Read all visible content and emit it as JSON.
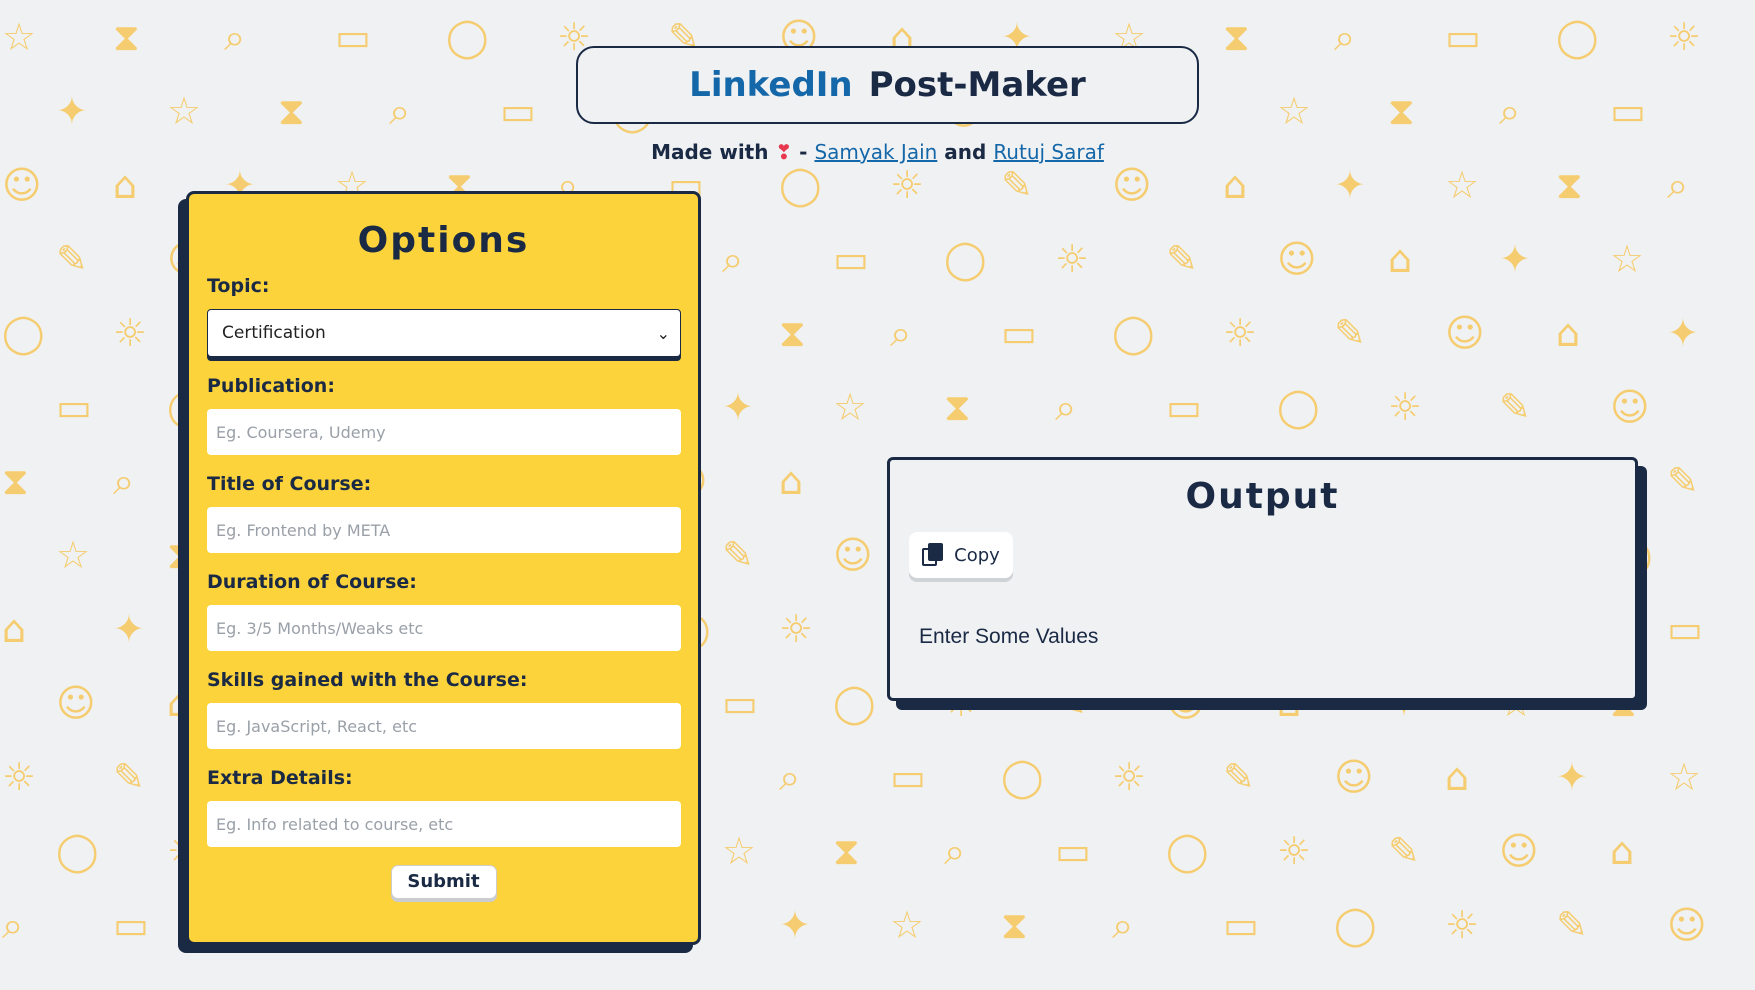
{
  "header": {
    "brand": "LinkedIn",
    "title_rest": "Post-Maker",
    "credit_prefix": "Made with",
    "heart": "❣",
    "credit_dash": "-",
    "author1": "Samyak Jain",
    "credit_and": "and",
    "author2": "Rutuj Saraf"
  },
  "options": {
    "heading": "Options",
    "topic_label": "Topic:",
    "topic_selected": "Certification",
    "publication_label": "Publication:",
    "publication_placeholder": "Eg. Coursera, Udemy",
    "course_title_label": "Title of Course:",
    "course_title_placeholder": "Eg. Frontend by META",
    "duration_label": "Duration of Course:",
    "duration_placeholder": "Eg. 3/5 Months/Weaks etc",
    "skills_label": "Skills gained with the Course:",
    "skills_placeholder": "Eg. JavaScript, React, etc",
    "extra_label": "Extra Details:",
    "extra_placeholder": "Eg. Info related to course, etc",
    "submit_label": "Submit"
  },
  "output": {
    "heading": "Output",
    "copy_label": "Copy",
    "placeholder_text": "Enter Some Values"
  },
  "colors": {
    "accent_yellow": "#fdd33b",
    "navy": "#1a2a45",
    "link_blue": "#1467a8",
    "pattern_icon": "#f6c75a"
  },
  "background_icons": [
    "☆",
    "⧗",
    "⌕",
    "▭",
    "◯",
    "☼",
    "✎",
    "☺",
    "⌂",
    "✦"
  ]
}
